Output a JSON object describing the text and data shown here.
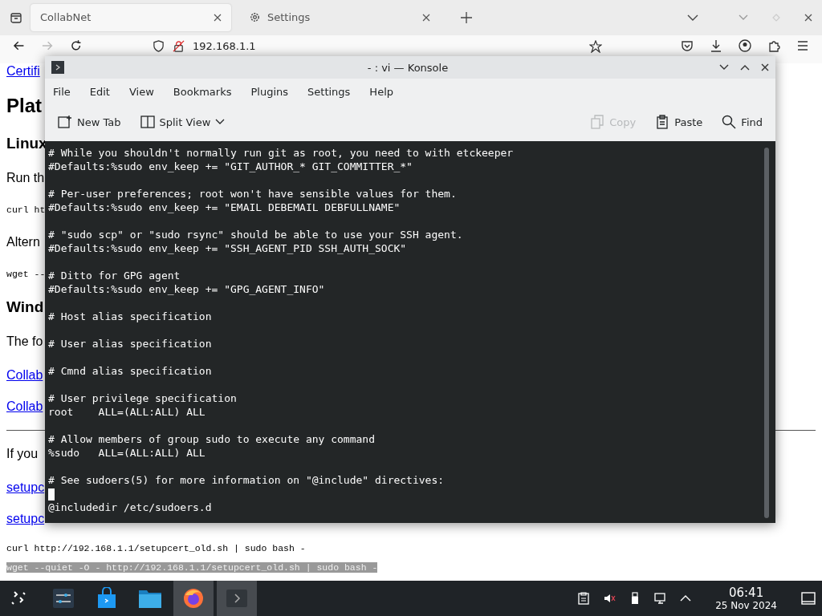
{
  "browser": {
    "tabs": [
      {
        "label": "CollabNet",
        "selected": true
      },
      {
        "label": "Settings",
        "selected": false
      }
    ],
    "url": "192.168.1.1",
    "page": [
      {
        "kind": "link",
        "text": "Certifi"
      },
      {
        "kind": "h1",
        "text": "Plat"
      },
      {
        "kind": "h2",
        "text": "Linux"
      },
      {
        "kind": "p",
        "text": "Run th"
      },
      {
        "kind": "code",
        "text": "curl ht"
      },
      {
        "kind": "p",
        "text": "Altern"
      },
      {
        "kind": "code",
        "text": "wget --"
      },
      {
        "kind": "h2",
        "text": "Wind"
      },
      {
        "kind": "p",
        "text": "The fo"
      },
      {
        "kind": "link",
        "text": "Collab"
      },
      {
        "kind": "link",
        "text": "Collab"
      },
      {
        "kind": "rule"
      },
      {
        "kind": "p",
        "text": "If you"
      },
      {
        "kind": "link",
        "text": "setupc"
      },
      {
        "kind": "link",
        "text": "setupc"
      },
      {
        "kind": "code",
        "text": "curl http://192.168.1.1/setupcert_old.sh | sudo bash -"
      },
      {
        "kind": "selected-code",
        "text": "wget --quiet -O - http://192.168.1.1/setupcert_old.sh | sudo bash -"
      }
    ]
  },
  "konsole": {
    "title": "- : vi — Konsole",
    "menu": [
      "File",
      "Edit",
      "View",
      "Bookmarks",
      "Plugins",
      "Settings",
      "Help"
    ],
    "toolbar": [
      {
        "label": "New Tab",
        "disabled": false
      },
      {
        "label": "Split View",
        "disabled": false
      },
      {
        "label": "Copy",
        "disabled": true
      },
      {
        "label": "Paste",
        "disabled": false
      },
      {
        "label": "Find",
        "disabled": false
      }
    ],
    "lines": [
      {
        "kind": "text",
        "text": "# While you shouldn't normally run git as root, you need to with etckeeper"
      },
      {
        "kind": "text",
        "text": "#Defaults:%sudo env_keep += \"GIT_AUTHOR_* GIT_COMMITTER_*\""
      },
      {
        "kind": "blank"
      },
      {
        "kind": "text",
        "text": "# Per-user preferences; root won't have sensible values for them."
      },
      {
        "kind": "text",
        "text": "#Defaults:%sudo env_keep += \"EMAIL DEBEMAIL DEBFULLNAME\""
      },
      {
        "kind": "blank"
      },
      {
        "kind": "text",
        "text": "# \"sudo scp\" or \"sudo rsync\" should be able to use your SSH agent."
      },
      {
        "kind": "text",
        "text": "#Defaults:%sudo env_keep += \"SSH_AGENT_PID SSH_AUTH_SOCK\""
      },
      {
        "kind": "blank"
      },
      {
        "kind": "text",
        "text": "# Ditto for GPG agent"
      },
      {
        "kind": "text",
        "text": "#Defaults:%sudo env_keep += \"GPG_AGENT_INFO\""
      },
      {
        "kind": "blank"
      },
      {
        "kind": "text",
        "text": "# Host alias specification"
      },
      {
        "kind": "blank"
      },
      {
        "kind": "text",
        "text": "# User alias specification"
      },
      {
        "kind": "blank"
      },
      {
        "kind": "text",
        "text": "# Cmnd alias specification"
      },
      {
        "kind": "blank"
      },
      {
        "kind": "text",
        "text": "# User privilege specification"
      },
      {
        "kind": "text",
        "text": "root    ALL=(ALL:ALL) ALL"
      },
      {
        "kind": "blank"
      },
      {
        "kind": "text",
        "text": "# Allow members of group sudo to execute any command"
      },
      {
        "kind": "text",
        "text": "%sudo   ALL=(ALL:ALL) ALL"
      },
      {
        "kind": "blank"
      },
      {
        "kind": "text",
        "text": "# See sudoers(5) for more information on \"@include\" directives:"
      },
      {
        "kind": "cursor"
      },
      {
        "kind": "text",
        "text": "@includedir /etc/sudoers.d"
      }
    ]
  },
  "taskbar": {
    "apps": [
      {
        "kind": "settings",
        "active": false
      },
      {
        "kind": "store",
        "active": false
      },
      {
        "kind": "files",
        "active": false
      },
      {
        "kind": "firefox",
        "active": true
      },
      {
        "kind": "terminal",
        "active": true
      }
    ],
    "time": "06:41",
    "date": "25 Nov 2024"
  }
}
